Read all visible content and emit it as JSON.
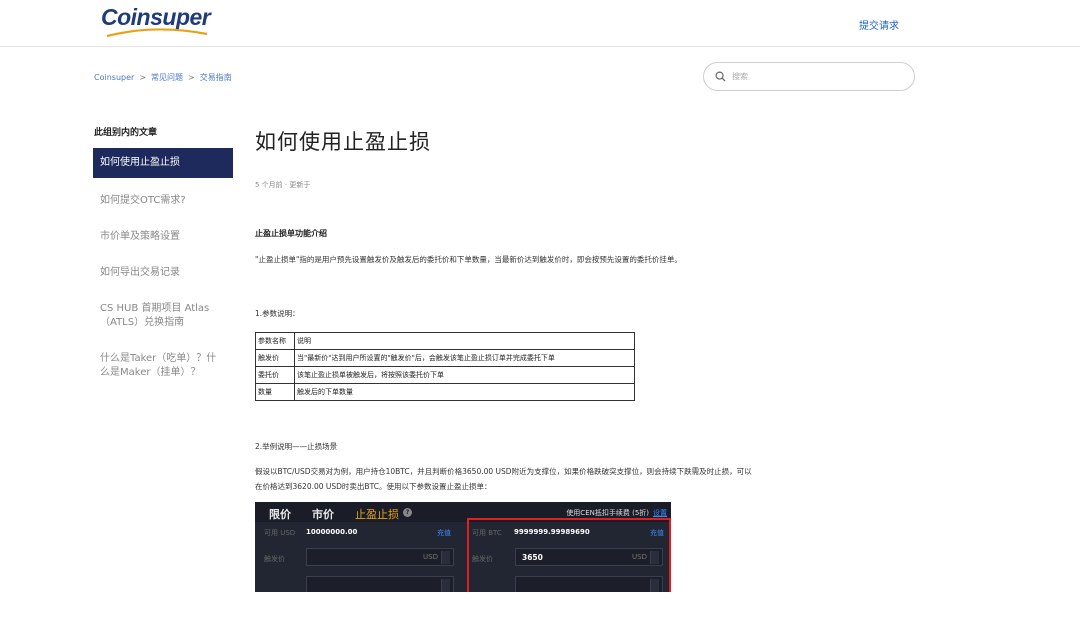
{
  "header": {
    "logo_text": "Coinsuper",
    "submit_request": "提交请求"
  },
  "breadcrumb": {
    "home": "Coinsuper",
    "sep1": ">",
    "level1": "常见问题",
    "sep2": ">",
    "level2": "交易指南"
  },
  "search": {
    "placeholder": "搜索"
  },
  "sidebar": {
    "title": "此组别内的文章",
    "items": [
      {
        "label": "如何使用止盈止损",
        "active": true
      },
      {
        "label": "如何提交OTC需求?"
      },
      {
        "label": "市价单及策略设置"
      },
      {
        "label": "如何导出交易记录"
      },
      {
        "label": "CS HUB 首期项目 Atlas（ATLS）兑换指南"
      },
      {
        "label": "什么是Taker（吃单）？什么是Maker（挂单）？"
      }
    ]
  },
  "article": {
    "title": "如何使用止盈止损",
    "meta": "5 个月前 · 更新于",
    "section1_heading": "止盈止损单功能介绍",
    "section1_text": "\"止盈止损单\"指的是用户预先设置触发价及触发后的委托价和下单数量，当最新价达到触发价时，即会按预先设置的委托价挂单。",
    "params_heading": "1.参数说明：",
    "params_table": [
      {
        "key": "参数名称",
        "value": "说明"
      },
      {
        "key": "触发价",
        "value": "当\"最新价\"达到用户所设置的\"触发价\"后，会触发该笔止盈止损订单并完成委托下单"
      },
      {
        "key": "委托价",
        "value": "该笔止盈止损单被触发后，将按照该委托价下单"
      },
      {
        "key": "数量",
        "value": "触发后的下单数量"
      }
    ],
    "example_heading": "2.举例说明——止损场景",
    "example_text": "假设以BTC/USD交易对为例，用户持仓10BTC，并且判断价格3650.00 USD附近为支撑位，如果价格跌破突支撑位，则会持续下跌需及时止损，可以在价格达到3620.00 USD时卖出BTC。使用以下参数设置止盈止损单："
  },
  "trade_panel": {
    "tab_limit": "限价",
    "tab_market": "市价",
    "tab_stop": "止盈止损",
    "help": "?",
    "fee_text": "使用CEN抵扣手续费 (5折)",
    "settings": "设置",
    "left": {
      "avail_label": "可用 USD",
      "avail_value": "10000000.00",
      "charge": "充值",
      "trigger_label": "触发价",
      "trigger_unit": "USD"
    },
    "right": {
      "avail_label": "可用 BTC",
      "avail_value": "9999999.99989690",
      "charge": "充值",
      "trigger_label": "触发价",
      "trigger_value": "3650",
      "trigger_unit": "USD"
    }
  }
}
